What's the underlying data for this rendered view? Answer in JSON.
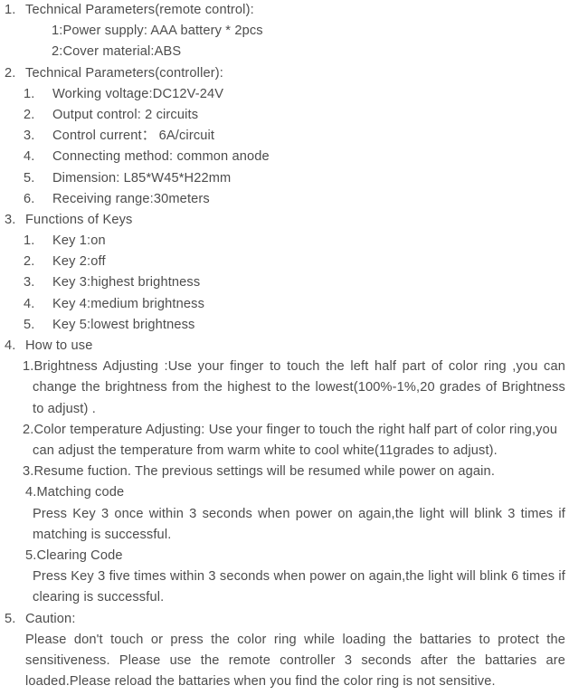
{
  "document": {
    "sections": [
      {
        "number": "1.",
        "heading": "Technical Parameters(remote control):",
        "colon_items": [
          "1:Power supply: AAA battery * 2pcs",
          "2:Cover material:ABS"
        ]
      },
      {
        "number": "2.",
        "heading": "Technical Parameters(controller):",
        "items": [
          {
            "marker": "1.",
            "text": "Working voltage:DC12V-24V"
          },
          {
            "marker": "2.",
            "text": "Output control: 2 circuits"
          },
          {
            "marker": "3.",
            "text": "Control current： 6A/circuit"
          },
          {
            "marker": "4.",
            "text": "Connecting method: common anode"
          },
          {
            "marker": "5.",
            "text": "Dimension: L85*W45*H22mm"
          },
          {
            "marker": "6.",
            "text": "Receiving range:30meters"
          }
        ]
      },
      {
        "number": "3.",
        "heading": "Functions of Keys",
        "items": [
          {
            "marker": "1.",
            "text": "Key 1:on"
          },
          {
            "marker": "2.",
            "text": "Key 2:off"
          },
          {
            "marker": "3.",
            "text": "Key 3:highest brightness"
          },
          {
            "marker": "4.",
            "text": "Key 4:medium brightness"
          },
          {
            "marker": "5.",
            "text": "Key 5:lowest brightness"
          }
        ]
      },
      {
        "number": "4.",
        "heading": "How to use",
        "paragraphs": {
          "brightness": "1.Brightness Adjusting :Use your finger to touch the left half part of color ring ,you can change the brightness from the highest to the lowest(100%-1%,20 grades of Brightness to adjust) .",
          "color_temperature": "2.Color temperature Adjusting: Use your finger to touch the right half part of color ring,you can adjust the temperature from warm white to cool white(11grades to adjust).",
          "resume": "3.Resume fuction. The previous settings will be resumed while power on again.",
          "matching_code_title": "4.Matching code",
          "matching_code_body": "Press Key 3 once within 3 seconds when power on again,the light will blink 3 times if matching is successful.",
          "clearing_code_title": "5.Clearing Code",
          "clearing_code_body": "Press Key 3 five times within 3 seconds when power on again,the light will blink 6 times if clearing is successful."
        }
      },
      {
        "number": "5.",
        "heading": "Caution:",
        "paragraphs": {
          "caution_body": "Please don't touch or press the color ring while loading the battaries to protect the sensitiveness. Please use the remote controller 3 seconds after the battaries are loaded.Please reload the battaries when you find the color ring is not sensitive."
        }
      }
    ]
  },
  "style": {
    "text_color": "#4c4c4c",
    "background_color": "#ffffff"
  }
}
